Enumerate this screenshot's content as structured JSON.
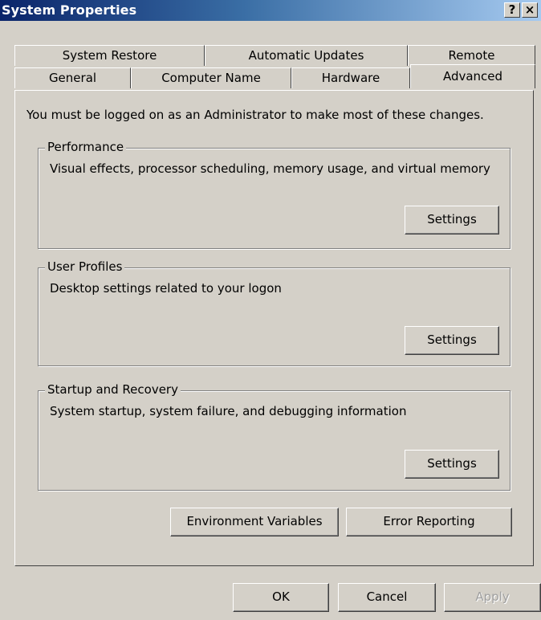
{
  "window": {
    "title": "System Properties",
    "help_label": "?",
    "close_label": "×"
  },
  "tabs": {
    "row1": [
      "System Restore",
      "Automatic Updates",
      "Remote"
    ],
    "row2": [
      "General",
      "Computer Name",
      "Hardware",
      "Advanced"
    ],
    "active": "Advanced"
  },
  "advanced": {
    "note": "You must be logged on as an Administrator to make most of these changes.",
    "performance": {
      "legend": "Performance",
      "text": "Visual effects, processor scheduling, memory usage, and virtual memory",
      "button": "Settings"
    },
    "user_profiles": {
      "legend": "User Profiles",
      "text": "Desktop settings related to your logon",
      "button": "Settings"
    },
    "startup": {
      "legend": "Startup and Recovery",
      "text": "System startup, system failure, and debugging information",
      "button": "Settings"
    },
    "env_button": "Environment Variables",
    "error_button": "Error Reporting"
  },
  "footer": {
    "ok": "OK",
    "cancel": "Cancel",
    "apply": "Apply"
  }
}
